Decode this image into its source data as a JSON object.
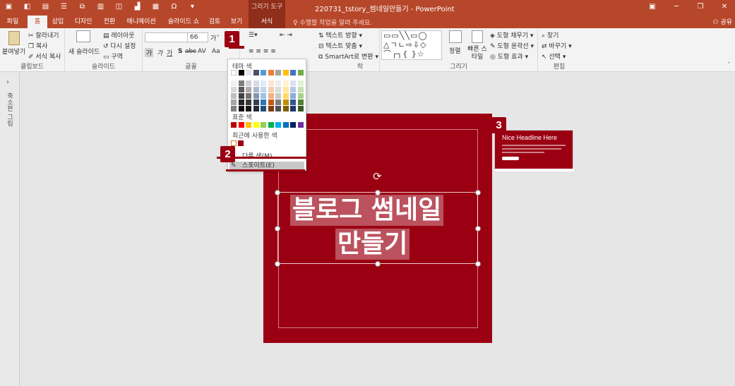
{
  "titlebar": {
    "document_title": "220731_tstory_썸네일만들기 - PowerPoint",
    "tools_context": "그리기 도구",
    "accent": "#b7472a"
  },
  "tabs": [
    {
      "label": "파일"
    },
    {
      "label": "홈"
    },
    {
      "label": "삽입"
    },
    {
      "label": "디자인"
    },
    {
      "label": "전환"
    },
    {
      "label": "애니메이션"
    },
    {
      "label": "슬라이드 쇼"
    },
    {
      "label": "검토"
    },
    {
      "label": "보기"
    },
    {
      "label": "서식"
    }
  ],
  "tellme": "수행할 작업을 알려 주세요.",
  "share": "공유",
  "ribbon": {
    "clipboard": {
      "paste": "붙여넣기",
      "cut": "잘라내기",
      "copy": "복사",
      "format_painter": "서식 복사",
      "label": "클립보드"
    },
    "slides": {
      "new_slide": "새 슬라이드",
      "layout": "레이아웃",
      "reset": "다시 설정",
      "section": "구역",
      "label": "슬라이드"
    },
    "font": {
      "font_size": "66",
      "label": "글꼴",
      "bold": "가",
      "italic": "가",
      "underline": "가",
      "shadow": "S",
      "strike": "abc",
      "spacing": "AV",
      "case": "Aa"
    },
    "paragraph": {
      "text_direction": "텍스트 방향",
      "align_text": "텍스트 맞춤",
      "smartart": "SmartArt로 변환",
      "label": "락"
    },
    "drawing": {
      "arrange": "정렬",
      "quick_styles": "빠른 스타일",
      "fill": "도형 채우기",
      "outline": "도형 윤곽선",
      "effects": "도형 효과",
      "label": "그리기"
    },
    "editing": {
      "find": "찾기",
      "replace": "바꾸기",
      "select": "선택",
      "label": "편집"
    }
  },
  "left_pane": {
    "label": "축소판 그림"
  },
  "slide": {
    "line1": "블로그 썸네일",
    "line2": "만들기",
    "background": "#9b0012"
  },
  "thumbnail": {
    "headline": "Nice Headline Here"
  },
  "dropdown": {
    "theme_colors": "테마 색",
    "standard_colors": "표준 색",
    "recent_colors": "최근에 사용한 색",
    "more_colors": "다른 색(M)...",
    "eyedropper": "스포이트(E)"
  },
  "badges": {
    "b1": "1",
    "b2": "2",
    "b3": "3"
  }
}
